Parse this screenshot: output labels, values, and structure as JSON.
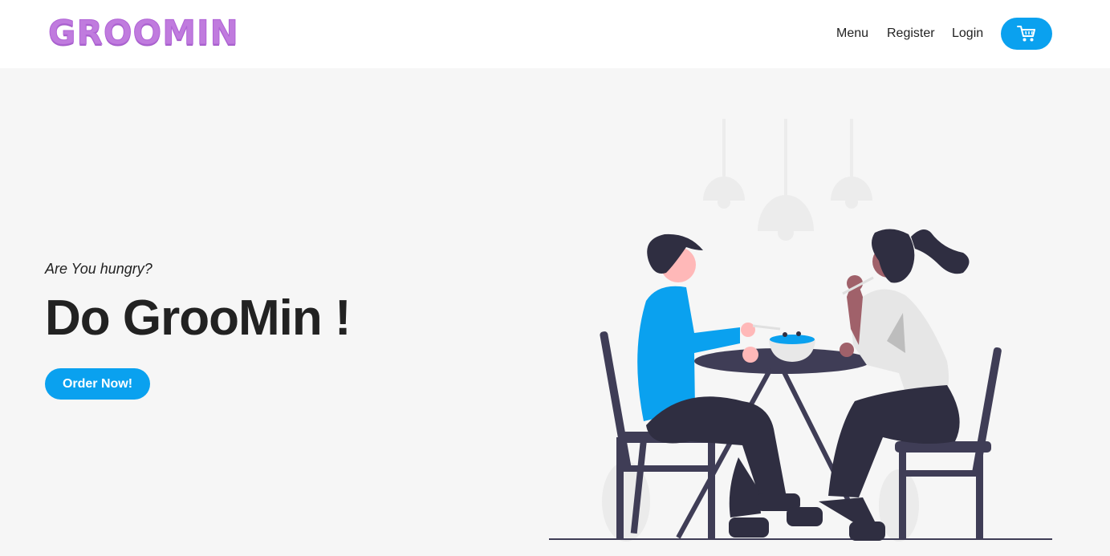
{
  "brand": {
    "logo_text": "GROOMIN"
  },
  "nav": {
    "items": [
      {
        "label": "Menu"
      },
      {
        "label": "Register"
      },
      {
        "label": "Login"
      }
    ],
    "cart_icon": "shopping-cart-icon"
  },
  "hero": {
    "tagline": "Are You hungry?",
    "headline": "Do GrooMin !",
    "cta_label": "Order Now!"
  },
  "colors": {
    "accent": "#0aa1ef",
    "logo": "#c07bde",
    "background": "#f6f6f6",
    "text": "#222222"
  }
}
